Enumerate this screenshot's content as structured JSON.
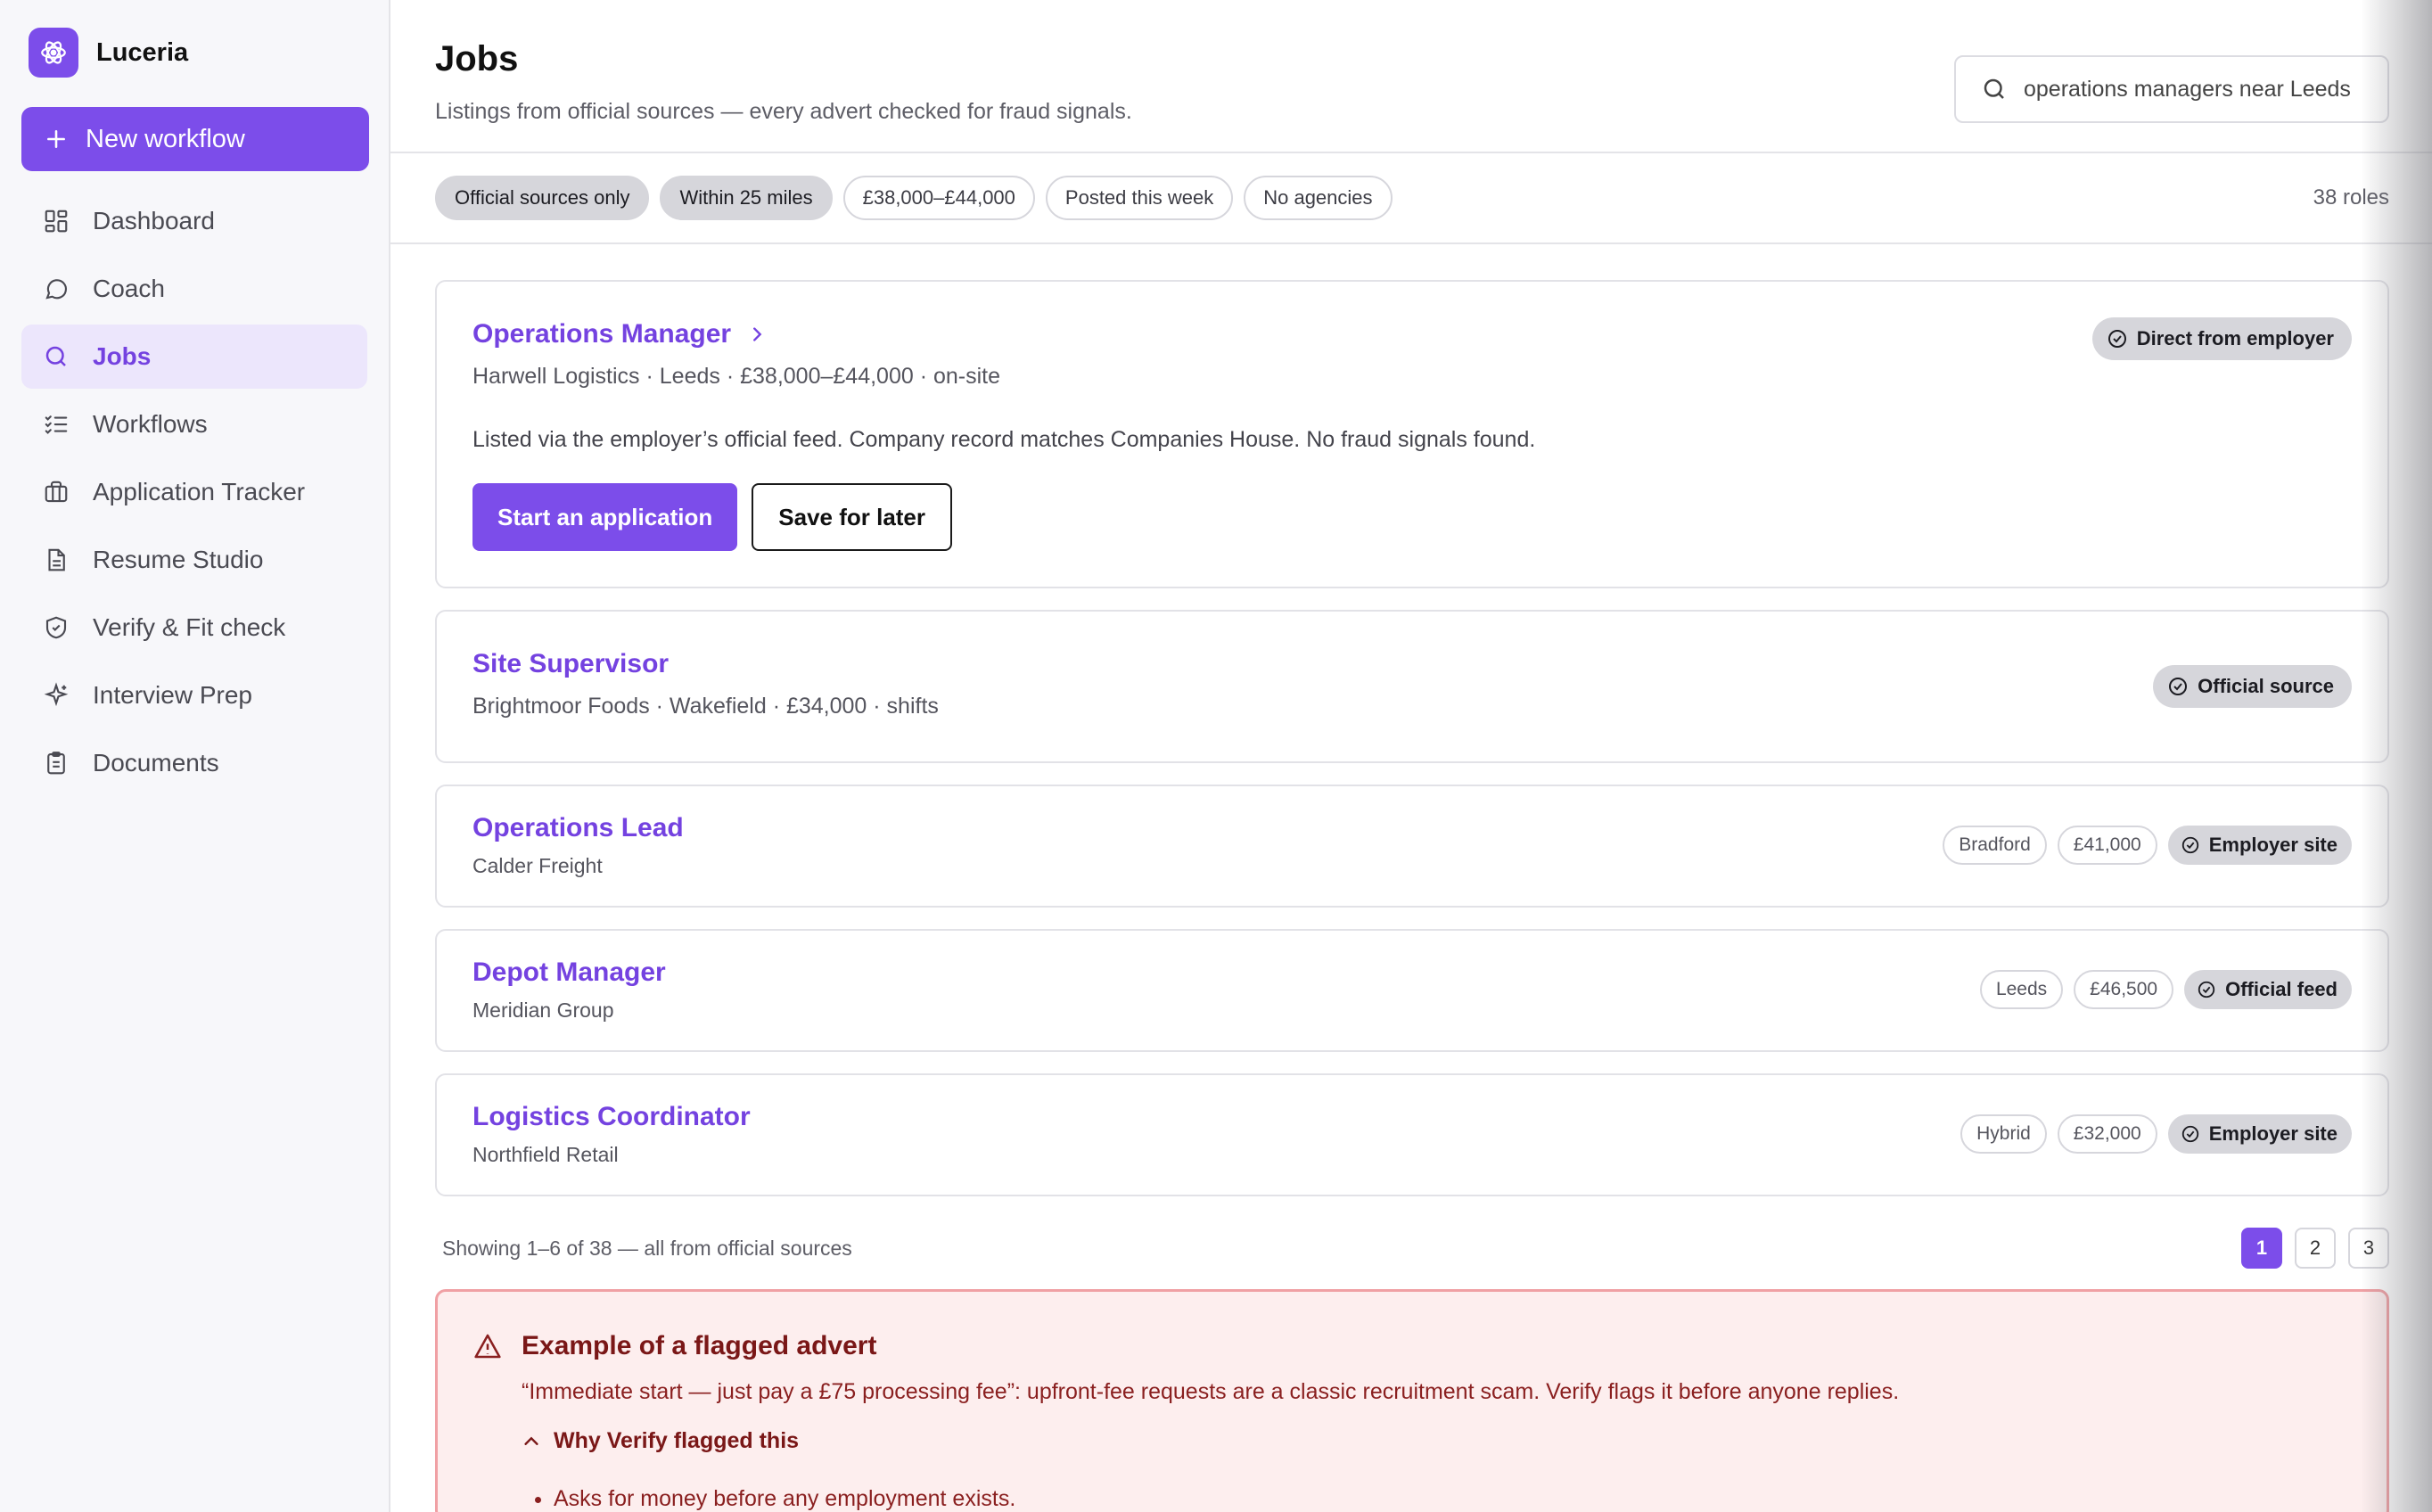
{
  "app": {
    "name": "Luceria"
  },
  "sidebar": {
    "new_workflow_label": "New workflow",
    "items": [
      {
        "label": "Dashboard",
        "icon": "dashboard-icon"
      },
      {
        "label": "Coach",
        "icon": "chat-bubble-icon"
      },
      {
        "label": "Jobs",
        "icon": "search-icon",
        "active": true
      },
      {
        "label": "Workflows",
        "icon": "checklist-icon"
      },
      {
        "label": "Application Tracker",
        "icon": "briefcase-icon"
      },
      {
        "label": "Resume Studio",
        "icon": "document-icon"
      },
      {
        "label": "Verify & Fit check",
        "icon": "shield-check-icon"
      },
      {
        "label": "Interview Prep",
        "icon": "sparkle-icon"
      },
      {
        "label": "Documents",
        "icon": "clipboard-icon"
      }
    ]
  },
  "header": {
    "title": "Jobs",
    "subtitle": "Listings from official sources — every advert checked for fraud signals.",
    "search_value": "operations managers near Leeds"
  },
  "filters": {
    "chips": [
      {
        "label": "Official sources only",
        "active": true
      },
      {
        "label": "Within 25 miles",
        "active": true
      },
      {
        "label": "£38,000–£44,000",
        "active": false
      },
      {
        "label": "Posted this week",
        "active": false
      },
      {
        "label": "No agencies",
        "active": false
      }
    ],
    "count": "38 roles"
  },
  "jobs": [
    {
      "title": "Operations Manager",
      "meta": "Harwell Logistics · Leeds · £38,000–£44,000 · on-site",
      "description": "Listed via the employer’s official feed. Company record matches Companies House. No fraud signals found.",
      "badge": "Direct from employer",
      "primary_action": "Start an application",
      "secondary_action": "Save for later"
    },
    {
      "title": "Site Supervisor",
      "meta": "Brightmoor Foods · Wakefield · £34,000 · shifts",
      "badge": "Official source"
    },
    {
      "title": "Operations Lead",
      "meta": "Calder Freight",
      "tags": [
        "Bradford",
        "£41,000"
      ],
      "badge": "Employer site"
    },
    {
      "title": "Depot Manager",
      "meta": "Meridian Group",
      "tags": [
        "Leeds",
        "£46,500"
      ],
      "badge": "Official feed"
    },
    {
      "title": "Logistics Coordinator",
      "meta": "Northfield Retail",
      "tags": [
        "Hybrid",
        "£32,000"
      ],
      "badge": "Employer site"
    }
  ],
  "pagination": {
    "showing": "Showing 1–6 of 38 — all from official sources",
    "pages": [
      "1",
      "2",
      "3"
    ],
    "current": "1"
  },
  "flagged": {
    "title": "Example of a flagged advert",
    "body": "“Immediate start — just pay a £75 processing fee”: upfront-fee requests are a classic recruitment scam. Verify flags it before anyone replies.",
    "toggle": "Why Verify flagged this",
    "reasons": [
      "Asks for money before any employment exists."
    ]
  },
  "colors": {
    "accent": "#7c4dea",
    "danger": "#8a1f1f",
    "danger_bg": "#fdeeee"
  }
}
